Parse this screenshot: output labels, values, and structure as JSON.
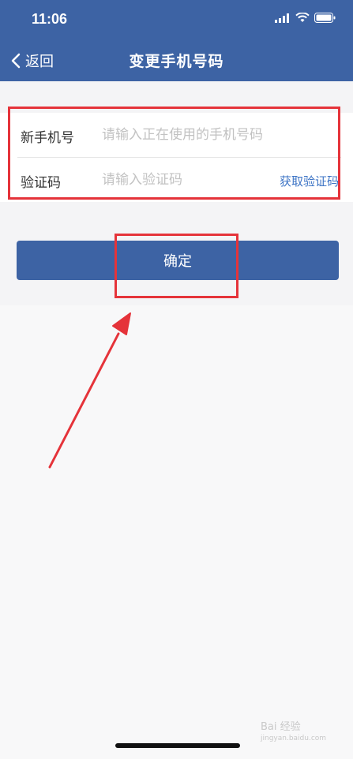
{
  "status_bar": {
    "time": "11:06",
    "icons": [
      "signal-icon",
      "wifi-icon",
      "battery-icon"
    ]
  },
  "nav": {
    "back_label": "返回",
    "title": "变更手机号码"
  },
  "form": {
    "phone": {
      "label": "新手机号",
      "placeholder": "请输入正在使用的手机号码",
      "value": ""
    },
    "code": {
      "label": "验证码",
      "placeholder": "请输入验证码",
      "value": "",
      "action_label": "获取验证码"
    }
  },
  "confirm_label": "确定",
  "watermark": {
    "line1": "Bai 经验",
    "line2": "jingyan.baidu.com"
  },
  "colors": {
    "primary": "#3d63a4",
    "link": "#3d74c5",
    "annotation": "#e5333a"
  }
}
